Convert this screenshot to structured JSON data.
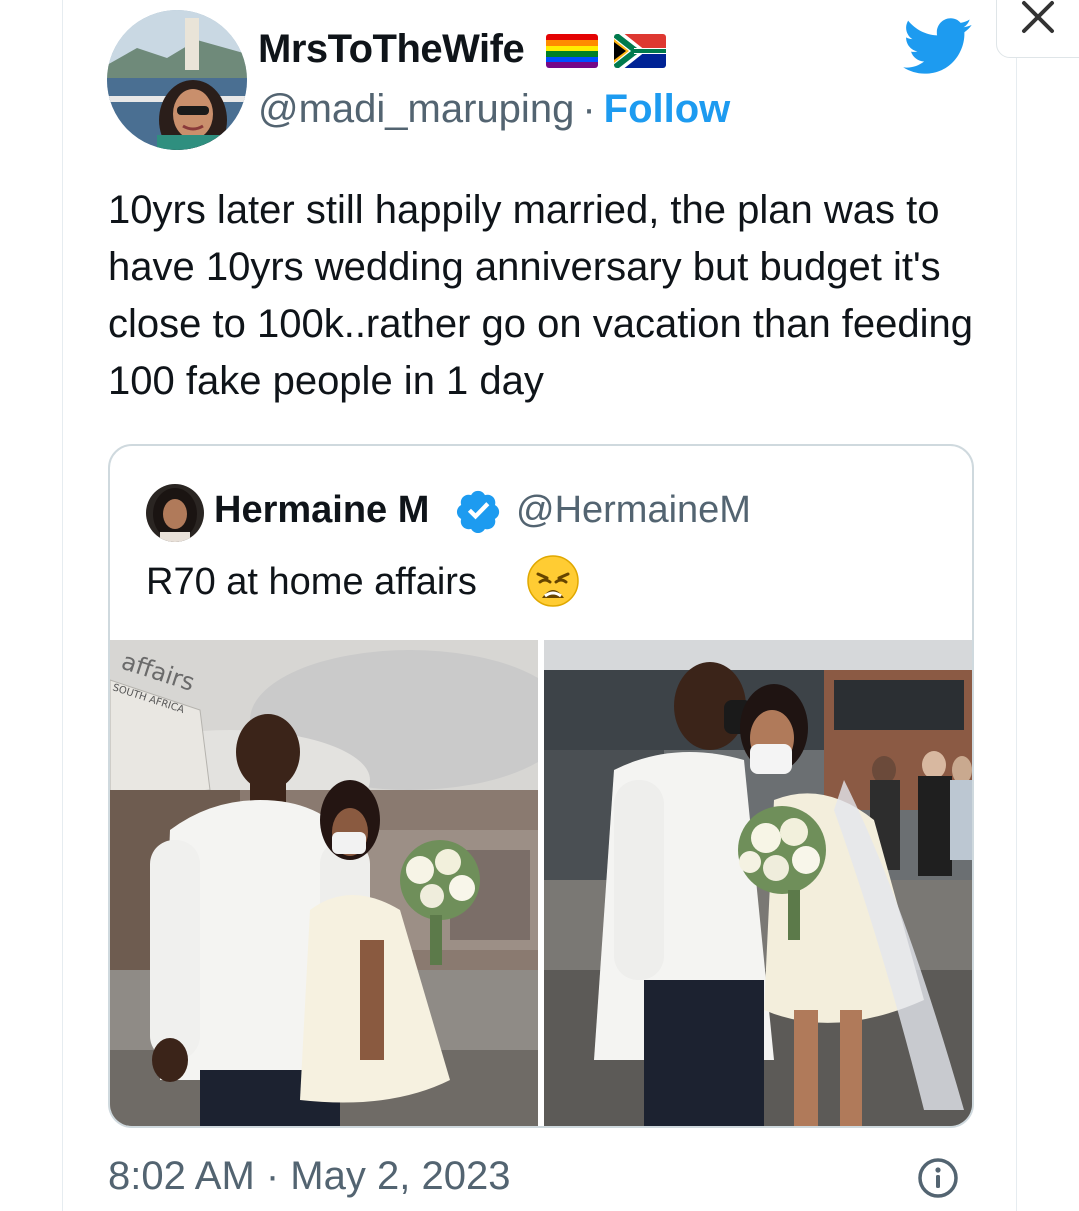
{
  "author": {
    "name": "MrsToTheWife",
    "handle": "@madi_maruping",
    "separator": "·",
    "follow_label": "Follow",
    "flags": [
      "rainbow-flag-icon",
      "south-africa-flag-icon"
    ]
  },
  "tweet": {
    "text": "10yrs later still happily married, the plan was to have 10yrs wedding anniversary but budget it's close to 100k..rather go on vacation than feeding 100 fake people in 1 day"
  },
  "quoted": {
    "name": "Hermaine M",
    "handle": "@HermaineM",
    "text": "R70 at home affairs",
    "emoji": "weary-face-icon",
    "photo1_sign": "affairs",
    "photo1_sign_sub": "SOUTH AFRICA"
  },
  "footer": {
    "timestamp": "8:02 AM · May 2, 2023"
  },
  "colors": {
    "link_blue": "#1d9bf0",
    "text": "#0f1419",
    "muted": "#536471",
    "border": "#cfd9de"
  }
}
